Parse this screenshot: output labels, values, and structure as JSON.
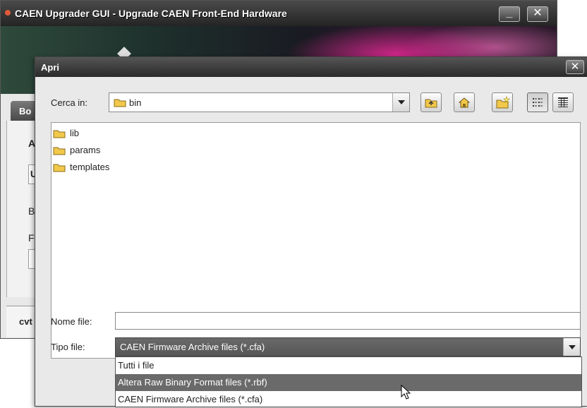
{
  "main_window": {
    "title": "CAEN Upgrader GUI - Upgrade CAEN Front-End Hardware",
    "minimize_label": "_",
    "close_label": "✕",
    "tab_label": "Bo",
    "side_letters": [
      "A",
      "U",
      "B",
      "F"
    ],
    "bottom_tab_label": "cvt"
  },
  "dialog": {
    "title": "Apri",
    "close_label": "✕",
    "look_in": {
      "label": "Cerca in:",
      "value": "bin"
    },
    "toolbar_icons": [
      "up-folder-icon",
      "home-icon",
      "new-folder-icon",
      "list-view-icon",
      "details-view-icon"
    ],
    "files": [
      {
        "name": "lib",
        "icon": "folder-icon"
      },
      {
        "name": "params",
        "icon": "folder-icon"
      },
      {
        "name": "templates",
        "icon": "folder-icon"
      }
    ],
    "file_name": {
      "label": "Nome file:",
      "value": ""
    },
    "file_type": {
      "label": "Tipo file:",
      "selected": "CAEN Firmware Archive files (*.cfa)",
      "options": [
        "Tutti i file",
        "Altera Raw Binary Format files (*.rbf)",
        "CAEN Firmware Archive files (*.cfa)"
      ],
      "highlighted_index": 1
    }
  }
}
